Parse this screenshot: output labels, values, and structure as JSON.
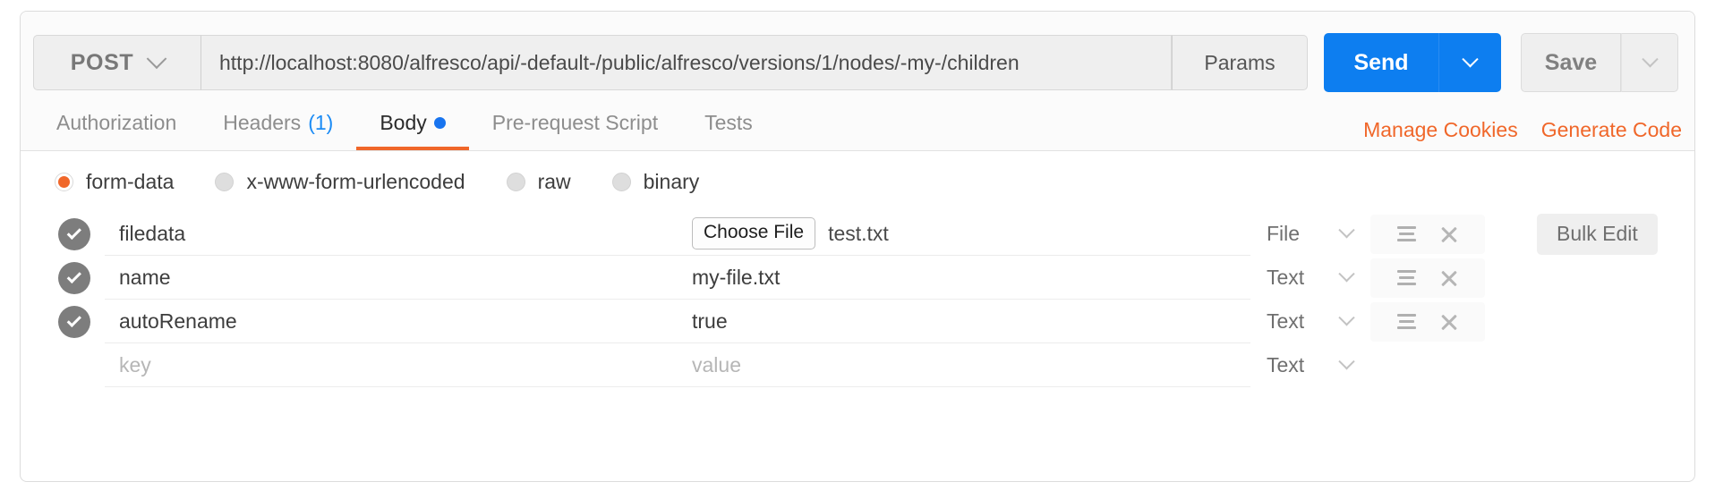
{
  "request": {
    "method": "POST",
    "method_caret_icon": "chevron-down-icon",
    "url": "http://localhost:8080/alfresco/api/-default-/public/alfresco/versions/1/nodes/-my-/children",
    "url_placeholder": "Enter request URL",
    "params_label": "Params",
    "send_label": "Send",
    "send_caret_icon": "chevron-down-icon",
    "save_label": "Save",
    "save_caret_icon": "chevron-down-icon"
  },
  "tabs": {
    "items": [
      {
        "label": "Authorization",
        "count": "",
        "dot": false,
        "active": false
      },
      {
        "label": "Headers",
        "count": "(1)",
        "dot": false,
        "active": false
      },
      {
        "label": "Body",
        "count": "",
        "dot": true,
        "active": true
      },
      {
        "label": "Pre-request Script",
        "count": "",
        "dot": false,
        "active": false
      },
      {
        "label": "Tests",
        "count": "",
        "dot": false,
        "active": false
      }
    ],
    "actions": [
      {
        "label": "Manage Cookies"
      },
      {
        "label": "Generate Code"
      }
    ]
  },
  "body": {
    "modes": [
      {
        "label": "form-data",
        "selected": true
      },
      {
        "label": "x-www-form-urlencoded",
        "selected": false
      },
      {
        "label": "raw",
        "selected": false
      },
      {
        "label": "binary",
        "selected": false
      }
    ],
    "bulk_edit_label": "Bulk Edit",
    "choose_file_label": "Choose File",
    "key_placeholder": "key",
    "value_placeholder": "value",
    "rows": [
      {
        "checked": true,
        "key": "filedata",
        "value": "test.txt",
        "is_file": true,
        "type": "File",
        "has_tools": true
      },
      {
        "checked": true,
        "key": "name",
        "value": "my-file.txt",
        "is_file": false,
        "type": "Text",
        "has_tools": true
      },
      {
        "checked": true,
        "key": "autoRename",
        "value": "true",
        "is_file": false,
        "type": "Text",
        "has_tools": true
      },
      {
        "checked": false,
        "key": "",
        "value": "",
        "is_file": false,
        "type": "Text",
        "has_tools": false
      }
    ]
  },
  "colors": {
    "accent_orange": "#f0672a",
    "send_blue": "#0d7ef0",
    "tab_dot_blue": "#1874ef",
    "checkbox_gray": "#7d7d7d"
  }
}
